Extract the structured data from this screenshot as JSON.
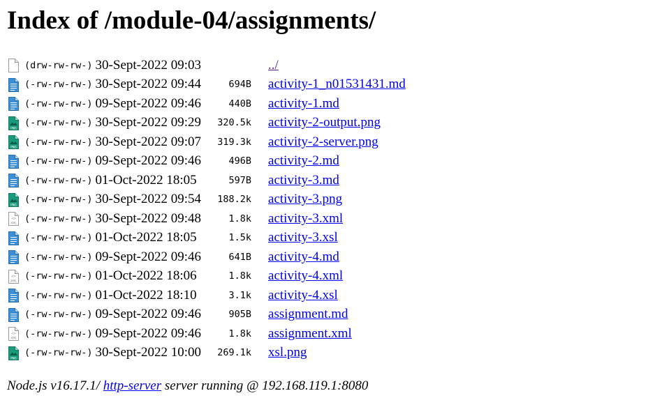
{
  "page": {
    "title": "Index of /module-04/assignments/"
  },
  "entries": [
    {
      "icon": "folder-icon",
      "perms": "(drw-rw-rw-)",
      "date": "30-Sept-2022 09:03",
      "size": "",
      "name": "../",
      "visited": true
    },
    {
      "icon": "text-file-icon",
      "perms": "(-rw-rw-rw-)",
      "date": "30-Sept-2022 09:44",
      "size": "694B",
      "name": "activity-1_n01531431.md",
      "visited": false
    },
    {
      "icon": "text-file-icon",
      "perms": "(-rw-rw-rw-)",
      "date": "09-Sept-2022 09:46",
      "size": "440B",
      "name": "activity-1.md",
      "visited": false
    },
    {
      "icon": "image-file-icon",
      "perms": "(-rw-rw-rw-)",
      "date": "30-Sept-2022 09:29",
      "size": "320.5k",
      "name": "activity-2-output.png",
      "visited": false
    },
    {
      "icon": "image-file-icon",
      "perms": "(-rw-rw-rw-)",
      "date": "30-Sept-2022 09:07",
      "size": "319.3k",
      "name": "activity-2-server.png",
      "visited": false
    },
    {
      "icon": "text-file-icon",
      "perms": "(-rw-rw-rw-)",
      "date": "09-Sept-2022 09:46",
      "size": "496B",
      "name": "activity-2.md",
      "visited": false
    },
    {
      "icon": "text-file-icon",
      "perms": "(-rw-rw-rw-)",
      "date": "01-Oct-2022 18:05",
      "size": "597B",
      "name": "activity-3.md",
      "visited": false
    },
    {
      "icon": "image-file-icon",
      "perms": "(-rw-rw-rw-)",
      "date": "30-Sept-2022 09:54",
      "size": "188.2k",
      "name": "activity-3.png",
      "visited": false
    },
    {
      "icon": "xml-file-icon",
      "perms": "(-rw-rw-rw-)",
      "date": "30-Sept-2022 09:48",
      "size": "1.8k",
      "name": "activity-3.xml",
      "visited": false
    },
    {
      "icon": "text-file-icon",
      "perms": "(-rw-rw-rw-)",
      "date": "01-Oct-2022 18:05",
      "size": "1.5k",
      "name": "activity-3.xsl",
      "visited": false
    },
    {
      "icon": "text-file-icon",
      "perms": "(-rw-rw-rw-)",
      "date": "09-Sept-2022 09:46",
      "size": "641B",
      "name": "activity-4.md",
      "visited": false
    },
    {
      "icon": "xml-file-icon",
      "perms": "(-rw-rw-rw-)",
      "date": "01-Oct-2022 18:06",
      "size": "1.8k",
      "name": "activity-4.xml",
      "visited": false
    },
    {
      "icon": "text-file-icon",
      "perms": "(-rw-rw-rw-)",
      "date": "01-Oct-2022 18:10",
      "size": "3.1k",
      "name": "activity-4.xsl",
      "visited": false
    },
    {
      "icon": "text-file-icon",
      "perms": "(-rw-rw-rw-)",
      "date": "09-Sept-2022 09:46",
      "size": "905B",
      "name": "assignment.md",
      "visited": false
    },
    {
      "icon": "xml-file-icon",
      "perms": "(-rw-rw-rw-)",
      "date": "09-Sept-2022 09:46",
      "size": "1.8k",
      "name": "assignment.xml",
      "visited": false
    },
    {
      "icon": "image-file-icon",
      "perms": "(-rw-rw-rw-)",
      "date": "30-Sept-2022 10:00",
      "size": "269.1k",
      "name": "xsl.png",
      "visited": false
    }
  ],
  "footer": {
    "prefix": "Node.js v16.17.1/ ",
    "link": "http-server",
    "suffix": " server running @ 192.168.119.1:8080"
  },
  "colors": {
    "link": "#0000ee",
    "visited_link": "#551a8b",
    "text_icon": "#3b8fd6",
    "image_icon": "#1a9a7c",
    "xml_icon": "#c8c8c8"
  }
}
